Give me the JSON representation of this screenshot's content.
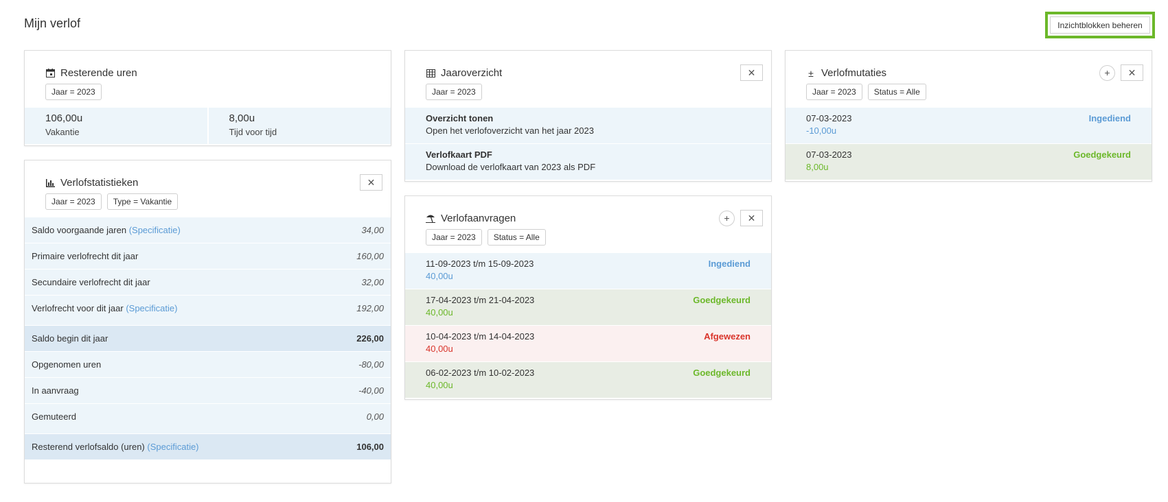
{
  "page": {
    "title": "Mijn verlof",
    "manage_button": "Inzichtblokken beheren"
  },
  "colors": {
    "accent_green": "#6cb82a",
    "status_blue": "#5b9bd5",
    "status_red": "#d9342b",
    "row_blue": "#edf5fa",
    "row_green": "#e8ede4"
  },
  "resterende": {
    "title": "Resterende uren",
    "icon": "calendar-icon",
    "chips": [
      "Jaar = 2023"
    ],
    "cells": [
      {
        "value": "106,00u",
        "label": "Vakantie"
      },
      {
        "value": "8,00u",
        "label": "Tijd voor tijd"
      }
    ]
  },
  "stats": {
    "title": "Verlofstatistieken",
    "icon": "bar-chart-icon",
    "chips": [
      "Jaar = 2023",
      "Type = Vakantie"
    ],
    "rows": [
      {
        "label": "Saldo voorgaande jaren",
        "spec": "(Specificatie)",
        "value": "34,00"
      },
      {
        "label": "Primaire verlofrecht dit jaar",
        "spec": "",
        "value": "160,00"
      },
      {
        "label": "Secundaire verlofrecht dit jaar",
        "spec": "",
        "value": "32,00"
      },
      {
        "label": "Verlofrecht voor dit jaar",
        "spec": "(Specificatie)",
        "value": "192,00"
      },
      {
        "label": "Saldo begin dit jaar",
        "spec": "",
        "value": "226,00"
      },
      {
        "label": "Opgenomen uren",
        "spec": "",
        "value": "-80,00"
      },
      {
        "label": "In aanvraag",
        "spec": "",
        "value": "-40,00"
      },
      {
        "label": "Gemuteerd",
        "spec": "",
        "value": "0,00"
      },
      {
        "label": "Resterend verlofsaldo (uren)",
        "spec": "(Specificatie)",
        "value": "106,00"
      }
    ]
  },
  "jaaroverzicht": {
    "title": "Jaaroverzicht",
    "icon": "table-icon",
    "chips": [
      "Jaar = 2023"
    ],
    "links": [
      {
        "title": "Overzicht tonen",
        "desc": "Open het verlofoverzicht van het jaar 2023"
      },
      {
        "title": "Verlofkaart PDF",
        "desc": "Download de verlofkaart van 2023 als PDF"
      }
    ]
  },
  "aanvragen": {
    "title": "Verlofaanvragen",
    "icon": "beach-umbrella-icon",
    "chips": [
      "Jaar = 2023",
      "Status = Alle"
    ],
    "items": [
      {
        "period": "11-09-2023 t/m 15-09-2023",
        "status": "Ingediend",
        "amount": "40,00u"
      },
      {
        "period": "17-04-2023 t/m 21-04-2023",
        "status": "Goedgekeurd",
        "amount": "40,00u"
      },
      {
        "period": "10-04-2023 t/m 14-04-2023",
        "status": "Afgewezen",
        "amount": "40,00u"
      },
      {
        "period": "06-02-2023 t/m 10-02-2023",
        "status": "Goedgekeurd",
        "amount": "40,00u"
      }
    ]
  },
  "mutaties": {
    "title": "Verlofmutaties",
    "icon": "plus-minus-icon",
    "chips": [
      "Jaar = 2023",
      "Status = Alle"
    ],
    "items": [
      {
        "date": "07-03-2023",
        "status": "Ingediend",
        "amount": "-10,00u"
      },
      {
        "date": "07-03-2023",
        "status": "Goedgekeurd",
        "amount": "8,00u"
      }
    ]
  }
}
